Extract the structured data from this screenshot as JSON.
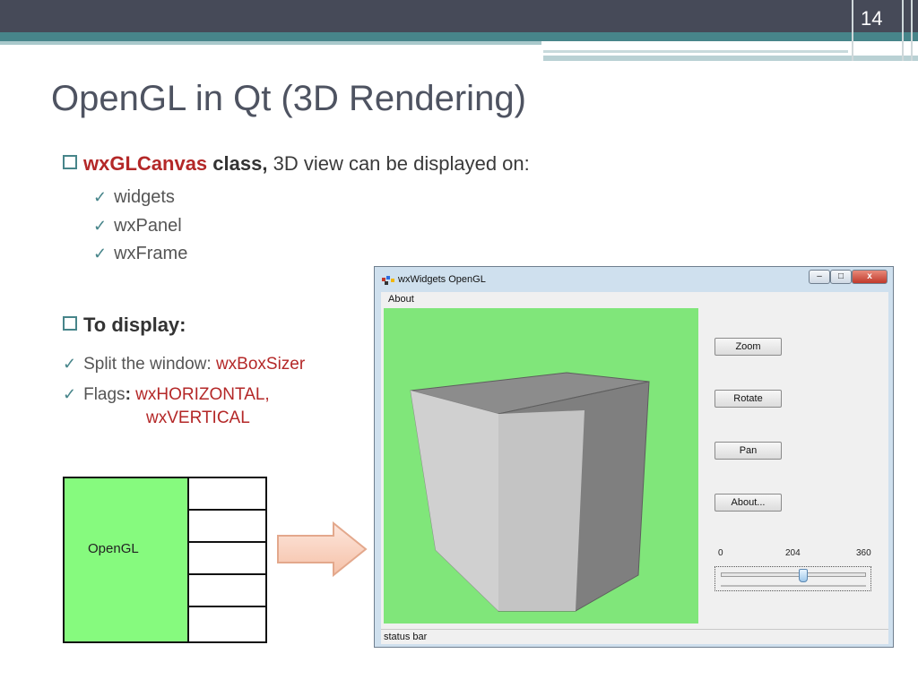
{
  "slide": {
    "number": "14",
    "title": "OpenGL in Qt  (3D Rendering)"
  },
  "bullet1": {
    "highlight": "wxGLCanvas",
    "bold": "class,",
    "text": " 3D view can be displayed on:",
    "items": [
      "widgets",
      "wxPanel",
      "wxFrame"
    ]
  },
  "bullet2": {
    "heading": "To display:",
    "item1_prefix": "Split the window: ",
    "item1_value": "wxBoxSizer",
    "item2_prefix": "Flags",
    "item2_colon": ":",
    "item2_value_line1": " wxHORIZONTAL,",
    "item2_value_line2": "wxVERTICAL"
  },
  "diagram": {
    "label": "OpenGL"
  },
  "window": {
    "title": "wxWidgets OpenGL",
    "menu": {
      "about": "About"
    },
    "buttons": {
      "zoom": "Zoom",
      "rotate": "Rotate",
      "pan": "Pan",
      "about": "About..."
    },
    "slider": {
      "min_label": "0",
      "value_label": "204",
      "max_label": "360",
      "value": 204,
      "min": 0,
      "max": 360
    },
    "status_bar": "status bar",
    "controls": {
      "minimize": "–",
      "maximize": "□",
      "close": "x"
    }
  },
  "colors": {
    "accent_teal": "#47858a",
    "highlight_red": "#b42828",
    "canvas_green": "#80e67a",
    "diagram_green": "#86fa7e"
  },
  "icons": {
    "bullet": "hollow-square-icon",
    "sub_bullet": "checkmark-icon",
    "arrow": "right-arrow-icon",
    "app": "wx-app-icon"
  }
}
